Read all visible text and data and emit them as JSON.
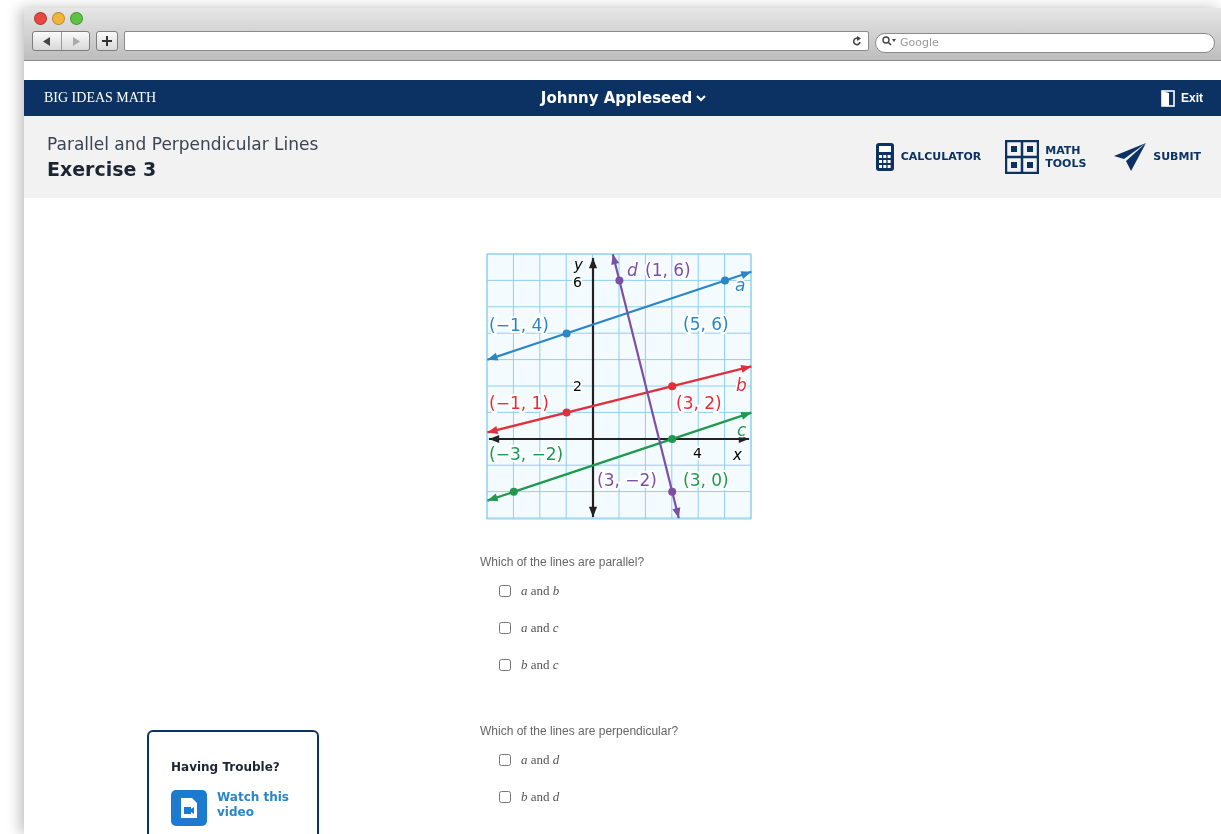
{
  "browser": {
    "search": {
      "placeholder": "Google"
    }
  },
  "topbar": {
    "brand": "BIG IDEAS MATH",
    "user": "Johnny Appleseed",
    "exit": "Exit"
  },
  "header": {
    "lesson": "Parallel and Perpendicular Lines",
    "exercise": "Exercise 3",
    "tools": [
      {
        "kind": "calculator",
        "label": "CALCULATOR"
      },
      {
        "kind": "math_tools",
        "label": "MATH TOOLS"
      },
      {
        "kind": "submit",
        "label": "SUBMIT"
      }
    ]
  },
  "graph": {
    "axis_x": "x",
    "axis_y": "y",
    "ticks": [
      "6",
      "2",
      "4"
    ],
    "lines": [
      {
        "name": "a",
        "color": "#2a86c6",
        "points": [
          {
            "label": "(−1, 4)"
          },
          {
            "label": "(5, 6)"
          }
        ]
      },
      {
        "name": "b",
        "color": "#e0303c",
        "points": [
          {
            "label": "(−1, 1)"
          },
          {
            "label": "(3, 2)"
          }
        ]
      },
      {
        "name": "c",
        "color": "#1e9a4e",
        "points": [
          {
            "label": "(−3, −2)"
          },
          {
            "label": "(3, 0)"
          }
        ]
      },
      {
        "name": "d",
        "color": "#7a4fa8",
        "points": [
          {
            "label": "(1, 6)"
          },
          {
            "label": "(3, −2)"
          }
        ]
      }
    ]
  },
  "questions": [
    {
      "prompt": "Which of the lines are parallel?",
      "options": [
        {
          "text": "*a* and *b*",
          "checked": false
        },
        {
          "text": "*a* and *c*",
          "checked": false
        },
        {
          "text": "*b* and *c*",
          "checked": false
        }
      ]
    },
    {
      "prompt": "Which of the lines are perpendicular?",
      "options": [
        {
          "text": "*a* and *d*",
          "checked": false
        },
        {
          "text": "*b* and *d*",
          "checked": false
        }
      ]
    }
  ],
  "help": {
    "title": "Having Trouble?",
    "link": "Watch this video"
  }
}
